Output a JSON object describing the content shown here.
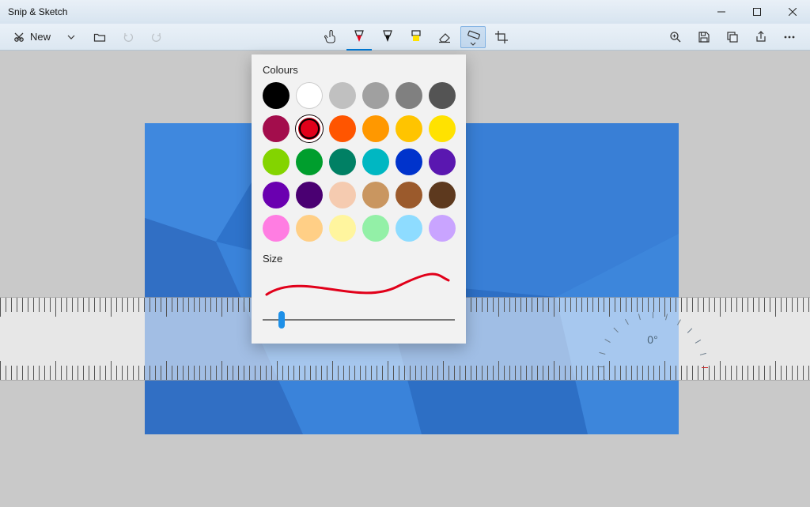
{
  "app": {
    "title": "Snip & Sketch"
  },
  "toolbar": {
    "new_label": "New"
  },
  "popup": {
    "colours_label": "Colours",
    "size_label": "Size",
    "selected_index": 7,
    "slider_percent": 10,
    "preview_color": "#e1001a",
    "colours": [
      {
        "name": "black",
        "hex": "#000000"
      },
      {
        "name": "white",
        "hex": "#ffffff"
      },
      {
        "name": "silver",
        "hex": "#c0c0c0"
      },
      {
        "name": "gray",
        "hex": "#a0a0a0"
      },
      {
        "name": "dark-gray",
        "hex": "#808080"
      },
      {
        "name": "charcoal",
        "hex": "#545454"
      },
      {
        "name": "dark-red",
        "hex": "#a30d4c"
      },
      {
        "name": "red",
        "hex": "#e1001a"
      },
      {
        "name": "orange-red",
        "hex": "#ff5500"
      },
      {
        "name": "orange",
        "hex": "#ff9800"
      },
      {
        "name": "gold",
        "hex": "#ffc400"
      },
      {
        "name": "yellow",
        "hex": "#ffe200"
      },
      {
        "name": "lime",
        "hex": "#83d400"
      },
      {
        "name": "green",
        "hex": "#009e2d"
      },
      {
        "name": "teal-green",
        "hex": "#008064"
      },
      {
        "name": "cyan",
        "hex": "#00b7c2"
      },
      {
        "name": "blue",
        "hex": "#0033cc"
      },
      {
        "name": "purple",
        "hex": "#5a17b0"
      },
      {
        "name": "violet",
        "hex": "#6a00b0"
      },
      {
        "name": "dark-purple",
        "hex": "#4a0072"
      },
      {
        "name": "peach",
        "hex": "#f5cbb0"
      },
      {
        "name": "tan",
        "hex": "#c99660"
      },
      {
        "name": "brown",
        "hex": "#9b5a2c"
      },
      {
        "name": "dark-brown",
        "hex": "#5d391e"
      },
      {
        "name": "pink",
        "hex": "#ff7de2"
      },
      {
        "name": "light-orange",
        "hex": "#ffcf86"
      },
      {
        "name": "light-yellow",
        "hex": "#fff59e"
      },
      {
        "name": "light-green",
        "hex": "#93f0a7"
      },
      {
        "name": "light-blue",
        "hex": "#8edcff"
      },
      {
        "name": "light-purple",
        "hex": "#c9a4ff"
      }
    ]
  },
  "ruler": {
    "angle_text": "0°"
  }
}
